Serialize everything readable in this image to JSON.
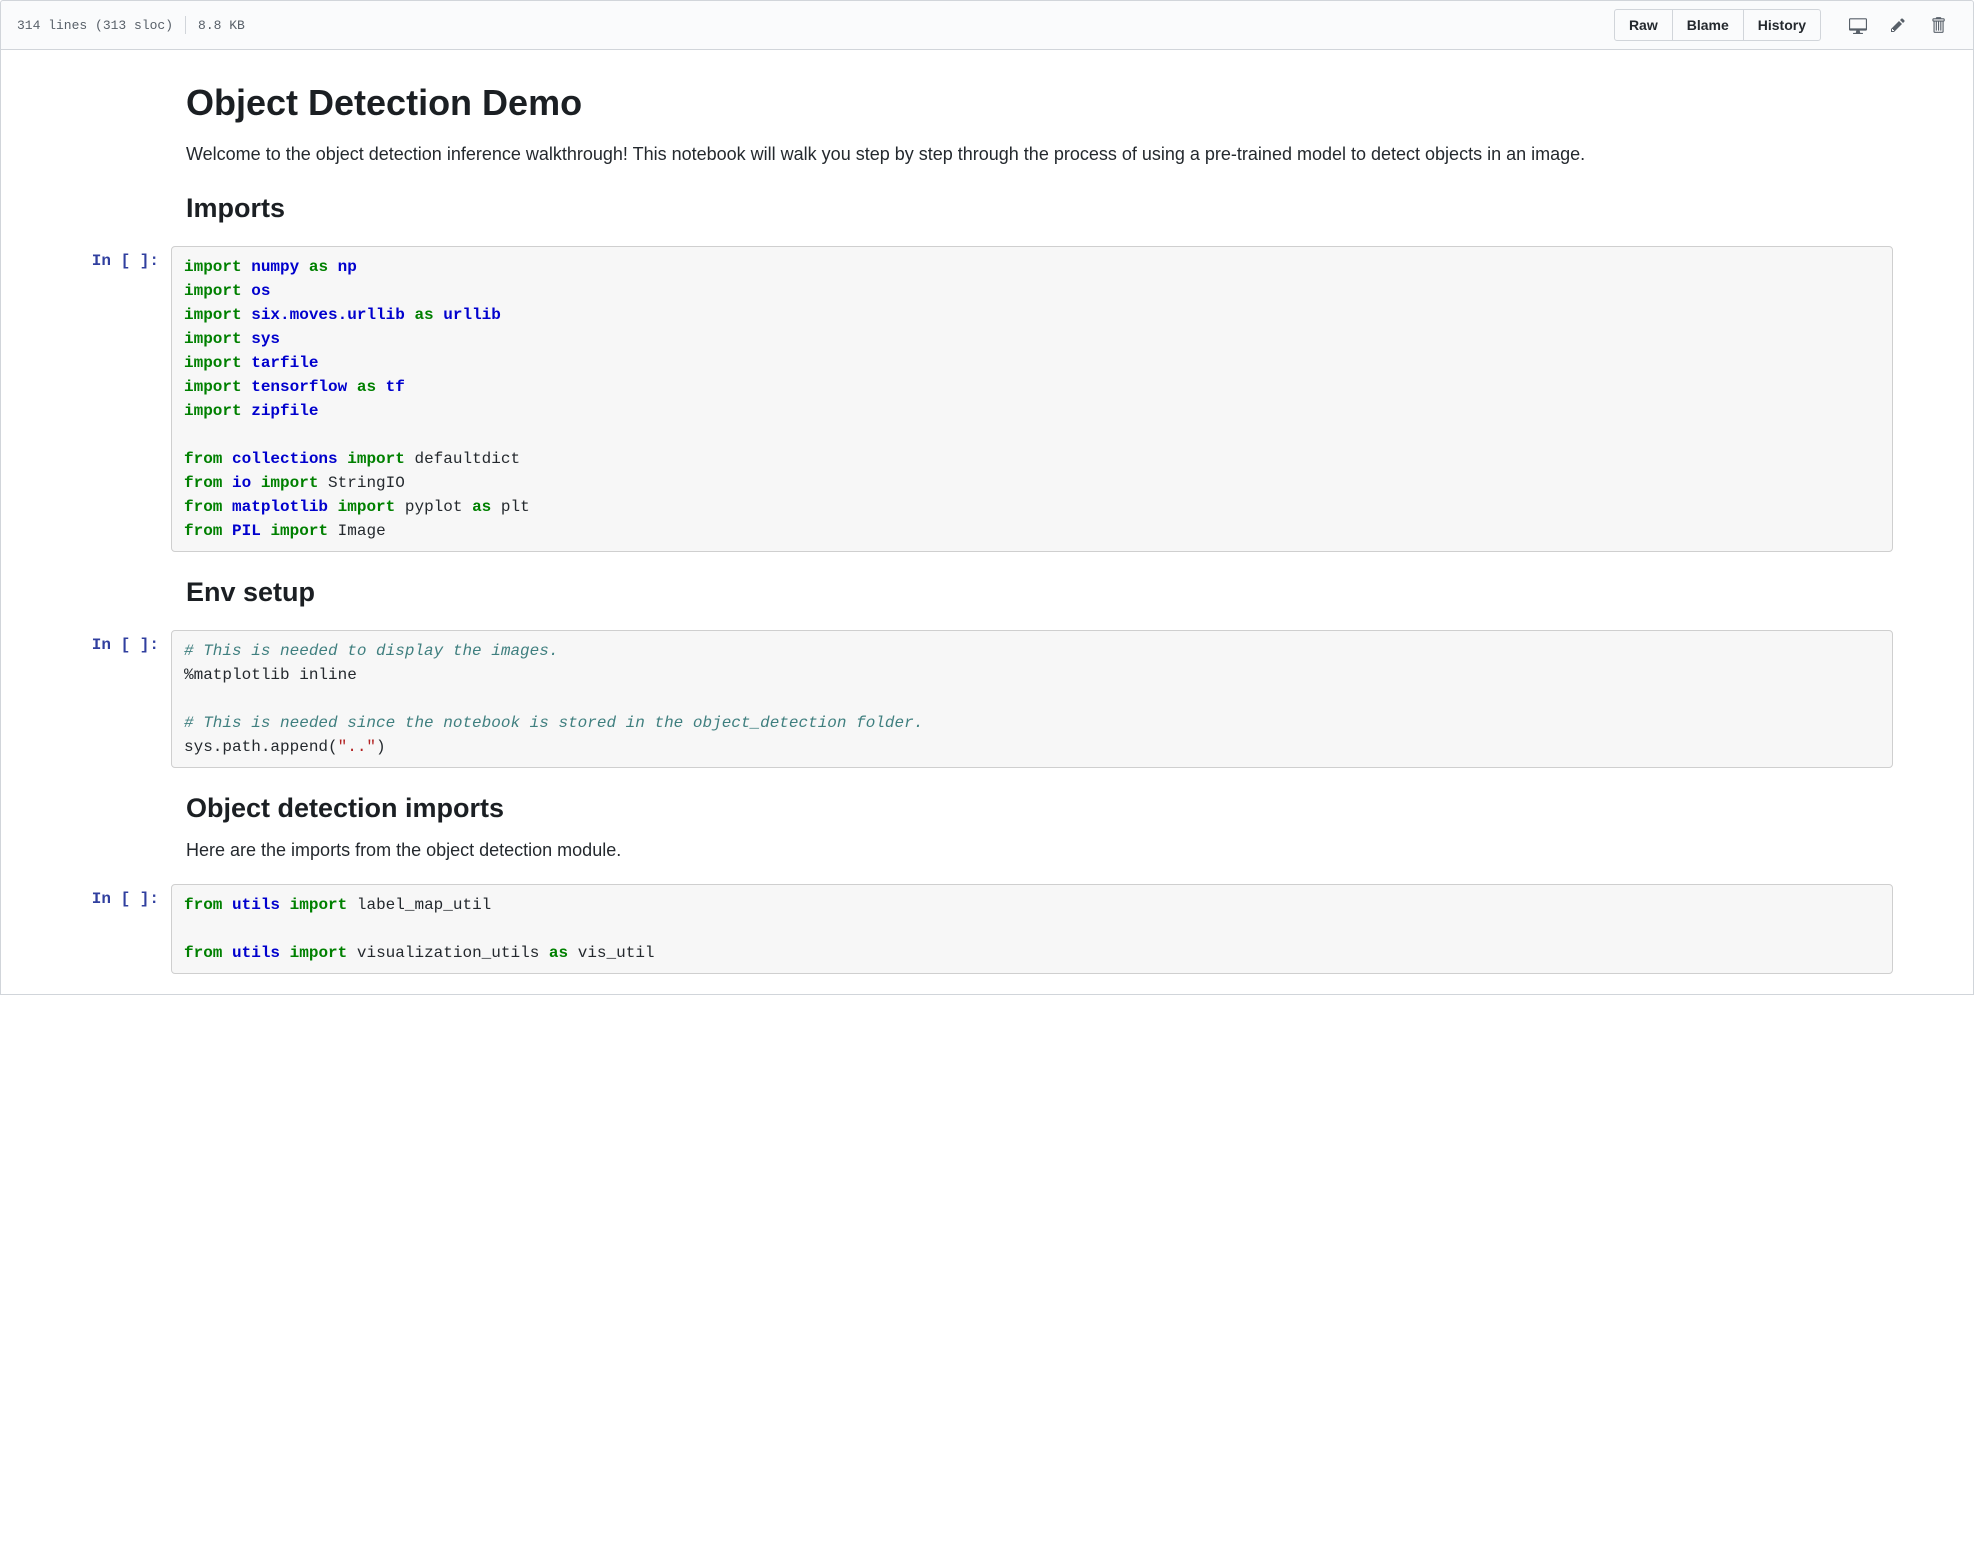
{
  "header": {
    "lines_text": "314 lines (313 sloc)",
    "size_text": "8.8 KB",
    "buttons": {
      "raw": "Raw",
      "blame": "Blame",
      "history": "History"
    }
  },
  "notebook": {
    "h1": "Object Detection Demo",
    "intro": "Welcome to the object detection inference walkthrough! This notebook will walk you step by step through the process of using a pre-trained model to detect objects in an image.",
    "h2_imports": "Imports",
    "h2_env": "Env setup",
    "h2_objdet": "Object detection imports",
    "objdet_p": "Here are the imports from the object detection module.",
    "prompt": "In [ ]:",
    "code1": {
      "l1_kw1": "import",
      "l1_nm": "numpy",
      "l1_kw2": "as",
      "l1_nm2": "np",
      "l2_kw": "import",
      "l2_nm": "os",
      "l3_kw1": "import",
      "l3_nm": "six.moves.urllib",
      "l3_kw2": "as",
      "l3_nm2": "urllib",
      "l4_kw": "import",
      "l4_nm": "sys",
      "l5_kw": "import",
      "l5_nm": "tarfile",
      "l6_kw1": "import",
      "l6_nm": "tensorflow",
      "l6_kw2": "as",
      "l6_nm2": "tf",
      "l7_kw": "import",
      "l7_nm": "zipfile",
      "l8_kw1": "from",
      "l8_nm": "collections",
      "l8_kw2": "import",
      "l8_p": "defaultdict",
      "l9_kw1": "from",
      "l9_nm": "io",
      "l9_kw2": "import",
      "l9_p": "StringIO",
      "l10_kw1": "from",
      "l10_nm": "matplotlib",
      "l10_kw2": "import",
      "l10_p1": "pyplot",
      "l10_kw3": "as",
      "l10_p2": "plt",
      "l11_kw1": "from",
      "l11_nm": "PIL",
      "l11_kw2": "import",
      "l11_p": "Image"
    },
    "code2": {
      "c1": "# This is needed to display the images.",
      "l1": "%matplotlib inline",
      "c2": "# This is needed since the notebook is stored in the object_detection folder.",
      "l2a": "sys.path.append(",
      "l2s": "\"..\"",
      "l2b": ")"
    },
    "code3": {
      "l1_kw1": "from",
      "l1_nm": "utils",
      "l1_kw2": "import",
      "l1_p": "label_map_util",
      "l2_kw1": "from",
      "l2_nm": "utils",
      "l2_kw2": "import",
      "l2_p1": "visualization_utils",
      "l2_kw3": "as",
      "l2_p2": "vis_util"
    }
  }
}
